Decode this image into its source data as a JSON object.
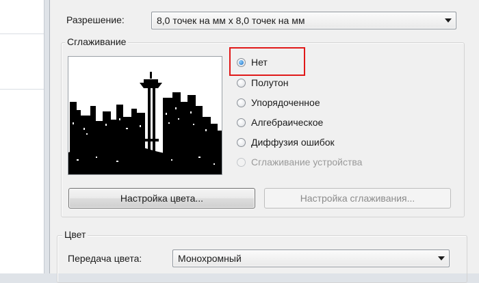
{
  "resolution": {
    "label": "Разрешение:",
    "value": "8,0 точек на мм x 8,0 точек на мм"
  },
  "dithering": {
    "title": "Сглаживание",
    "selected": "none",
    "options": [
      {
        "id": "none",
        "label": "Нет",
        "checked": true,
        "enabled": true
      },
      {
        "id": "halftone",
        "label": "Полутон",
        "checked": false,
        "enabled": true
      },
      {
        "id": "ordered",
        "label": "Упорядоченное",
        "checked": false,
        "enabled": true
      },
      {
        "id": "algebraic",
        "label": "Алгебраическое",
        "checked": false,
        "enabled": true
      },
      {
        "id": "error-diffusion",
        "label": "Диффузия ошибок",
        "checked": false,
        "enabled": true
      },
      {
        "id": "device",
        "label": "Сглаживание устройства",
        "checked": false,
        "enabled": false
      }
    ],
    "color_settings_button": "Настройка цвета...",
    "dither_settings_button": "Настройка сглаживания..."
  },
  "color": {
    "title": "Цвет",
    "transfer_label": "Передача цвета:",
    "transfer_value": "Монохромный"
  },
  "colors": {
    "highlight": "#e01818",
    "radio_checked": "#1c6fc4"
  }
}
